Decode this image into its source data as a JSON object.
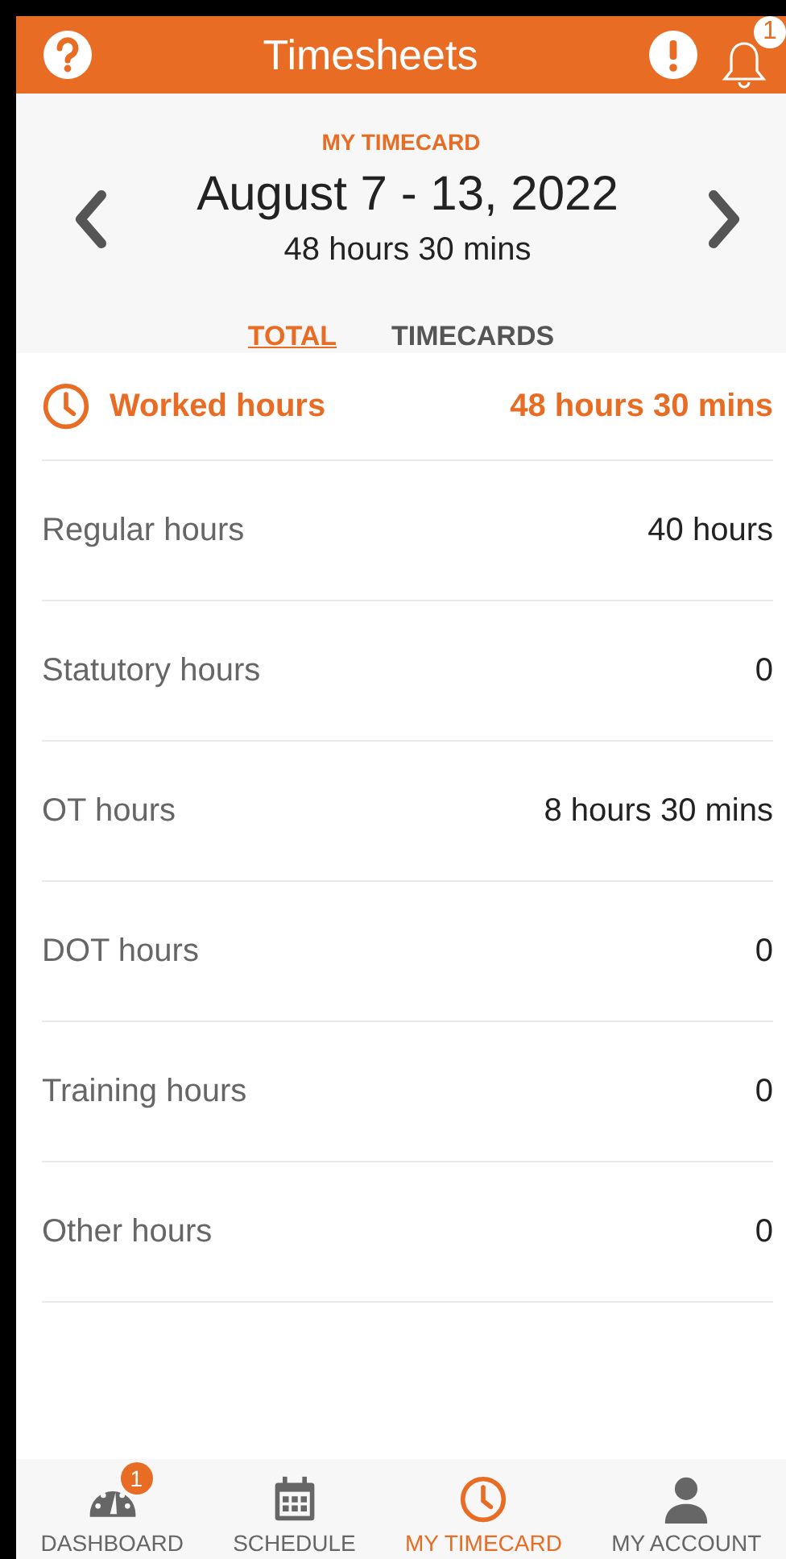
{
  "header": {
    "title": "Timesheets",
    "notification_count": "1"
  },
  "timecard": {
    "label": "MY TIMECARD",
    "period": "August 7 - 13, 2022",
    "total": "48 hours 30 mins"
  },
  "tabs": [
    {
      "label": "TOTAL",
      "selected": true
    },
    {
      "label": "TIMECARDS",
      "selected": false
    }
  ],
  "worked": {
    "label": "Worked hours",
    "value": "48 hours 30 mins"
  },
  "rows": [
    {
      "label": "Regular hours",
      "value": "40 hours"
    },
    {
      "label": "Statutory hours",
      "value": "0"
    },
    {
      "label": "OT hours",
      "value": "8 hours 30 mins"
    },
    {
      "label": "DOT hours",
      "value": "0"
    },
    {
      "label": "Training hours",
      "value": "0"
    },
    {
      "label": "Other hours",
      "value": "0"
    }
  ],
  "nav": [
    {
      "kind": "dashboard",
      "label": "DASHBOARD",
      "selected": false,
      "badge": "1"
    },
    {
      "kind": "schedule",
      "label": "SCHEDULE",
      "selected": false
    },
    {
      "kind": "timecard",
      "label": "MY TIMECARD",
      "selected": true
    },
    {
      "kind": "account",
      "label": "MY ACCOUNT",
      "selected": false
    }
  ]
}
